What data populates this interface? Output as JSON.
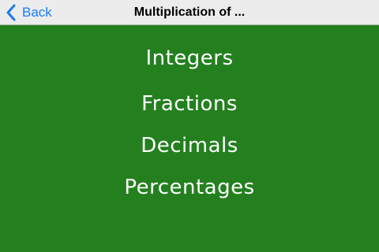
{
  "navbar": {
    "back_label": "Back",
    "back_icon": "chevron-left-icon",
    "title": "Multiplication of ..."
  },
  "menu": {
    "items": [
      {
        "label": "Integers"
      },
      {
        "label": "Fractions"
      },
      {
        "label": "Decimals"
      },
      {
        "label": "Percentages"
      }
    ]
  },
  "colors": {
    "background": "#24801f",
    "navbar": "#ececec",
    "accent": "#1a7cf5",
    "text": "#ffffff"
  }
}
